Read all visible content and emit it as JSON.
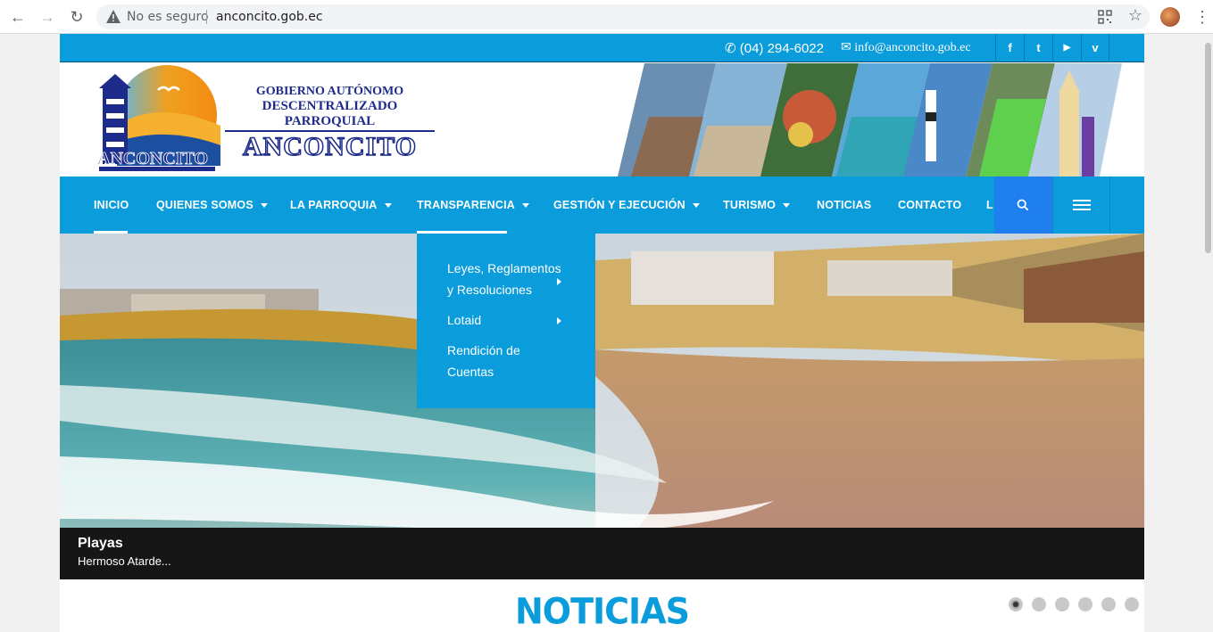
{
  "browser": {
    "security_label": "No es seguro",
    "url": "anconcito.gob.ec"
  },
  "topbar": {
    "phone": "(04) 294-6022",
    "email": "info@anconcito.gob.ec",
    "social": [
      {
        "icon": "facebook-icon",
        "glyph": "f"
      },
      {
        "icon": "twitter-icon",
        "glyph": "t"
      },
      {
        "icon": "youtube-icon",
        "glyph": "▶"
      },
      {
        "icon": "vimeo-icon",
        "glyph": "v"
      }
    ]
  },
  "header": {
    "logo_text": "ANCONCITO",
    "line1": "GOBIERNO AUTÓNOMO",
    "line2": "DESCENTRALIZADO PARROQUIAL",
    "line3": "ANCONCITO"
  },
  "nav": {
    "items": [
      {
        "label": "INICIO"
      },
      {
        "label": "QUIENES SOMOS"
      },
      {
        "label": "LA PARROQUIA"
      },
      {
        "label": "TRANSPARENCIA"
      },
      {
        "label": "GESTIÓN Y EJECUCIÓN"
      },
      {
        "label": "TURISMO"
      },
      {
        "label": "NOTICIAS"
      },
      {
        "label": "CONTACTO"
      },
      {
        "label": "L"
      }
    ]
  },
  "dropdown": {
    "items": [
      {
        "line1": "Leyes, Reglamentos",
        "line2": "y Resoluciones"
      },
      {
        "line1": "Lotaid"
      },
      {
        "line1": "Rendición de",
        "line2": "Cuentas"
      }
    ]
  },
  "slide": {
    "title": "Playas",
    "subtitle": "Hermoso Atarde..."
  },
  "section": {
    "title": "NOTICIAS"
  },
  "slider_dots": 6,
  "colors": {
    "primary": "#0a9cdb",
    "search_bg": "#1f7fef",
    "logo_blue": "#1d2b8a"
  }
}
